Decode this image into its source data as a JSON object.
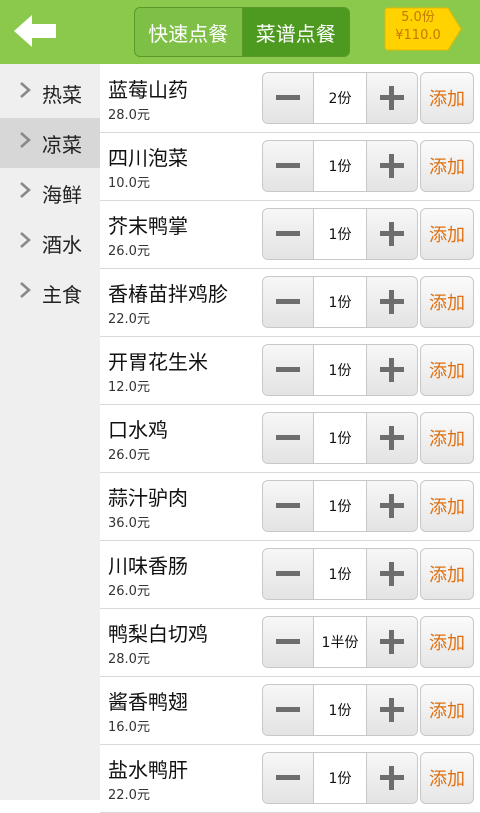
{
  "header": {
    "tabs": [
      "快速点餐",
      "菜谱点餐"
    ],
    "cart": {
      "count": "5.0份",
      "total": "¥110.0"
    }
  },
  "sidebar": {
    "items": [
      {
        "label": "热菜"
      },
      {
        "label": "凉菜"
      },
      {
        "label": "海鲜"
      },
      {
        "label": "酒水"
      },
      {
        "label": "主食"
      }
    ],
    "selected": "凉菜"
  },
  "dishes": [
    {
      "name": "蓝莓山药",
      "price": "28.0元",
      "qty": "2份",
      "add": "添加"
    },
    {
      "name": "四川泡菜",
      "price": "10.0元",
      "qty": "1份",
      "add": "添加"
    },
    {
      "name": "芥末鸭掌",
      "price": "26.0元",
      "qty": "1份",
      "add": "添加"
    },
    {
      "name": "香椿苗拌鸡胗",
      "price": "22.0元",
      "qty": "1份",
      "add": "添加"
    },
    {
      "name": "开胃花生米",
      "price": "12.0元",
      "qty": "1份",
      "add": "添加"
    },
    {
      "name": "口水鸡",
      "price": "26.0元",
      "qty": "1份",
      "add": "添加"
    },
    {
      "name": "蒜汁驴肉",
      "price": "36.0元",
      "qty": "1份",
      "add": "添加"
    },
    {
      "name": "川味香肠",
      "price": "26.0元",
      "qty": "1份",
      "add": "添加"
    },
    {
      "name": "鸭梨白切鸡",
      "price": "28.0元",
      "qty": "1半份",
      "add": "添加"
    },
    {
      "name": "酱香鸭翅",
      "price": "16.0元",
      "qty": "1份",
      "add": "添加"
    },
    {
      "name": "盐水鸭肝",
      "price": "22.0元",
      "qty": "1份",
      "add": "添加"
    }
  ],
  "colors": {
    "header_bg": "#8ac94c",
    "tab_active": "#4e9a21",
    "cart_badge": "#ffd700",
    "add_text": "#e07010"
  },
  "icons": {
    "back": "back-arrow-icon",
    "chevron": "chevron-right-icon",
    "minus": "minus-icon",
    "plus": "plus-icon"
  }
}
